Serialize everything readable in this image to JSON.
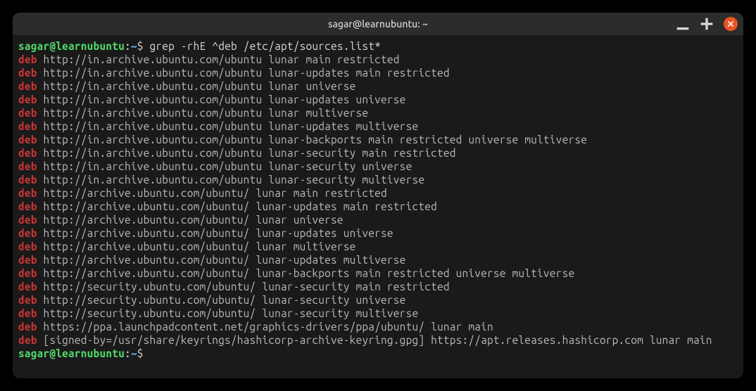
{
  "titlebar": {
    "title": "sagar@learnubuntu: ~"
  },
  "prompt": {
    "user_host": "sagar@learnubuntu",
    "sep1": ":",
    "path": "~",
    "sep2": "$ "
  },
  "command": "grep -rhE ^deb /etc/apt/sources.list*",
  "output": [
    {
      "match": "deb",
      "rest": " http://in.archive.ubuntu.com/ubuntu lunar main restricted"
    },
    {
      "match": "deb",
      "rest": " http://in.archive.ubuntu.com/ubuntu lunar-updates main restricted"
    },
    {
      "match": "deb",
      "rest": " http://in.archive.ubuntu.com/ubuntu lunar universe"
    },
    {
      "match": "deb",
      "rest": " http://in.archive.ubuntu.com/ubuntu lunar-updates universe"
    },
    {
      "match": "deb",
      "rest": " http://in.archive.ubuntu.com/ubuntu lunar multiverse"
    },
    {
      "match": "deb",
      "rest": " http://in.archive.ubuntu.com/ubuntu lunar-updates multiverse"
    },
    {
      "match": "deb",
      "rest": " http://in.archive.ubuntu.com/ubuntu lunar-backports main restricted universe multiverse"
    },
    {
      "match": "deb",
      "rest": " http://in.archive.ubuntu.com/ubuntu lunar-security main restricted"
    },
    {
      "match": "deb",
      "rest": " http://in.archive.ubuntu.com/ubuntu lunar-security universe"
    },
    {
      "match": "deb",
      "rest": " http://in.archive.ubuntu.com/ubuntu lunar-security multiverse"
    },
    {
      "match": "deb",
      "rest": " http://archive.ubuntu.com/ubuntu/ lunar main restricted"
    },
    {
      "match": "deb",
      "rest": " http://archive.ubuntu.com/ubuntu/ lunar-updates main restricted"
    },
    {
      "match": "deb",
      "rest": " http://archive.ubuntu.com/ubuntu/ lunar universe"
    },
    {
      "match": "deb",
      "rest": " http://archive.ubuntu.com/ubuntu/ lunar-updates universe"
    },
    {
      "match": "deb",
      "rest": " http://archive.ubuntu.com/ubuntu/ lunar multiverse"
    },
    {
      "match": "deb",
      "rest": " http://archive.ubuntu.com/ubuntu/ lunar-updates multiverse"
    },
    {
      "match": "deb",
      "rest": " http://archive.ubuntu.com/ubuntu/ lunar-backports main restricted universe multiverse"
    },
    {
      "match": "deb",
      "rest": " http://security.ubuntu.com/ubuntu/ lunar-security main restricted"
    },
    {
      "match": "deb",
      "rest": " http://security.ubuntu.com/ubuntu/ lunar-security universe"
    },
    {
      "match": "deb",
      "rest": " http://security.ubuntu.com/ubuntu/ lunar-security multiverse"
    },
    {
      "match": "deb",
      "rest": " https://ppa.launchpadcontent.net/graphics-drivers/ppa/ubuntu/ lunar main"
    },
    {
      "match": "deb",
      "rest": " [signed-by=/usr/share/keyrings/hashicorp-archive-keyring.gpg] https://apt.releases.hashicorp.com lunar main"
    }
  ]
}
